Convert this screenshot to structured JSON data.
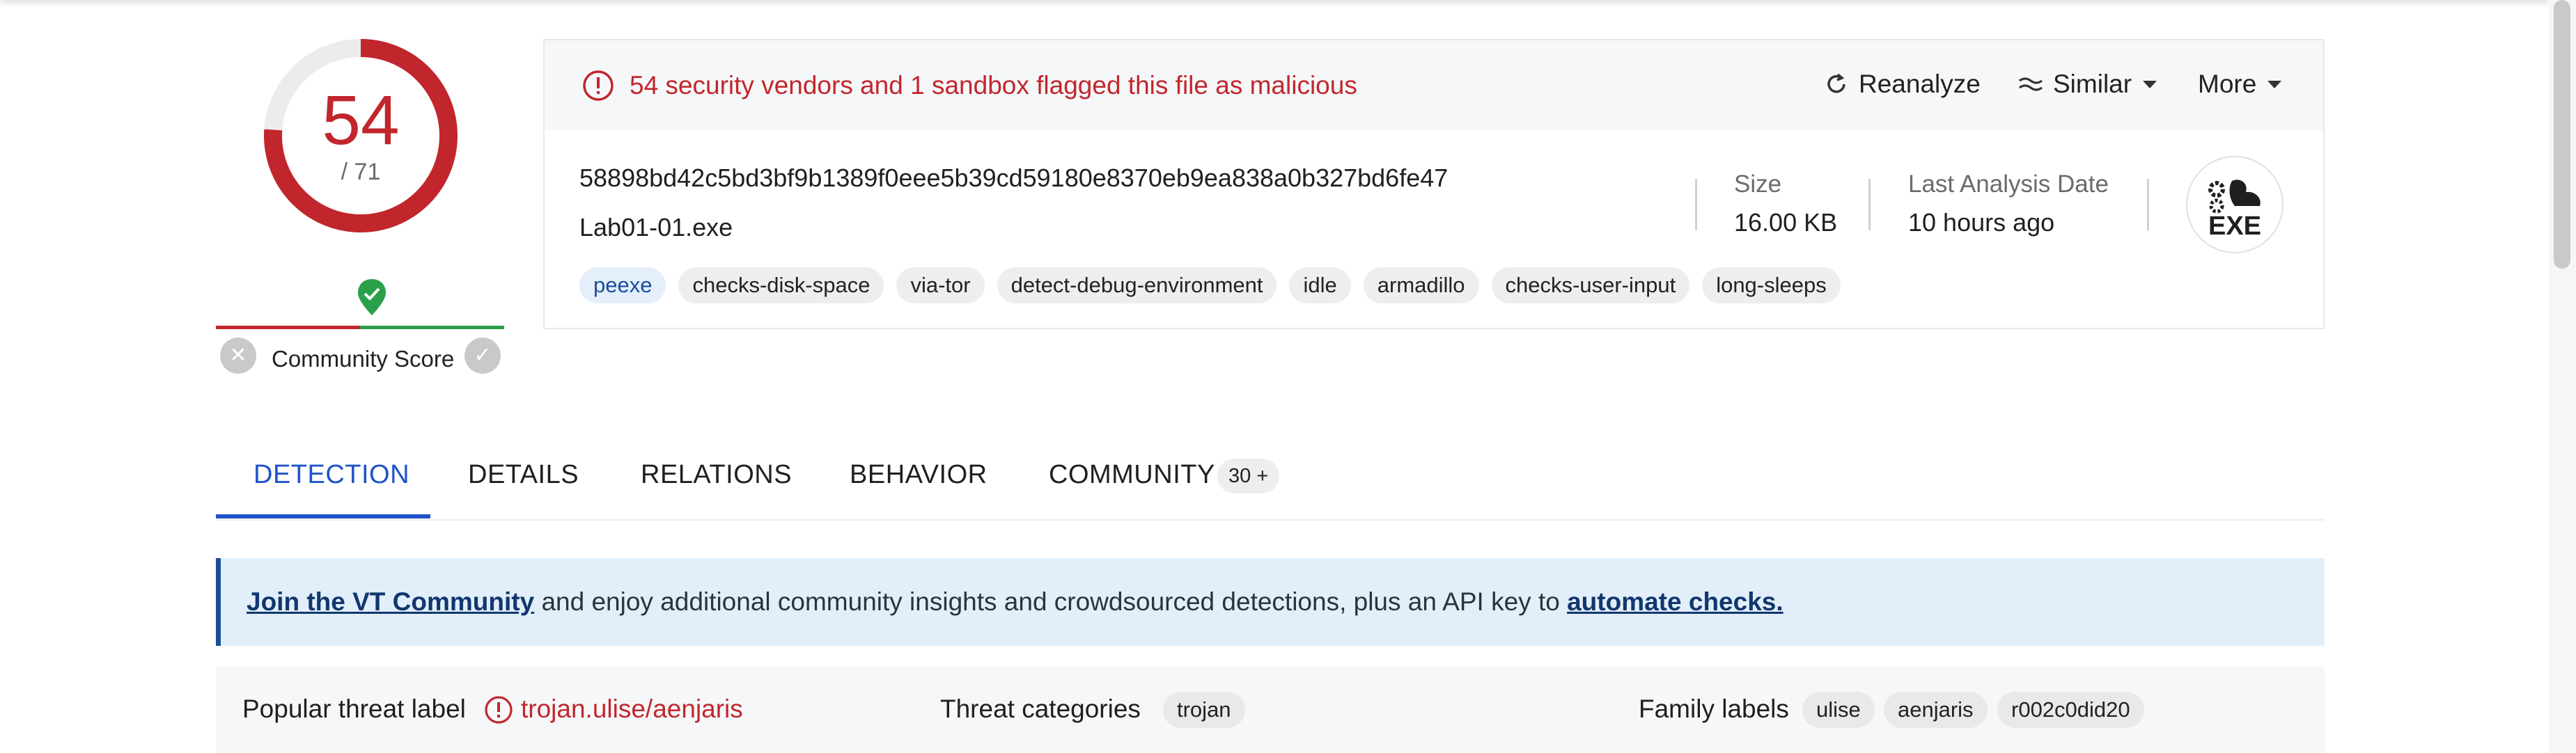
{
  "score": {
    "detections": "54",
    "total": "/ 71"
  },
  "community": {
    "label": "Community Score"
  },
  "alert": {
    "text": "54 security vendors and 1 sandbox flagged this file as malicious"
  },
  "actions": {
    "reanalyze": "Reanalyze",
    "similar": "Similar",
    "more": "More"
  },
  "file": {
    "hash": "58898bd42c5bd3bf9b1389f0eee5b39cd59180e8370eb9ea838a0b327bd6fe47",
    "name": "Lab01-01.exe",
    "tags": [
      "peexe",
      "checks-disk-space",
      "via-tor",
      "detect-debug-environment",
      "idle",
      "armadillo",
      "checks-user-input",
      "long-sleeps"
    ],
    "size_label": "Size",
    "size_value": "16.00 KB",
    "date_label": "Last Analysis Date",
    "date_value": "10 hours ago",
    "type_icon_label": "EXE"
  },
  "tabs": [
    {
      "label": "DETECTION",
      "active": true
    },
    {
      "label": "DETAILS"
    },
    {
      "label": "RELATIONS"
    },
    {
      "label": "BEHAVIOR"
    },
    {
      "label": "COMMUNITY",
      "badge": "30 +"
    }
  ],
  "banner": {
    "link1": "Join the VT Community",
    "text": " and enjoy additional community insights and crowdsourced detections, plus an API key to ",
    "link2": "automate checks."
  },
  "threat": {
    "popular_label": "Popular threat label",
    "popular_value": "trojan.ulise/aenjaris",
    "categories_label": "Threat categories",
    "categories": [
      "trojan"
    ],
    "family_label": "Family labels",
    "families": [
      "ulise",
      "aenjaris",
      "r002c0did20"
    ]
  },
  "colors": {
    "malicious": "#c2262d",
    "accent": "#1e53c9",
    "positive": "#2aa04a"
  }
}
